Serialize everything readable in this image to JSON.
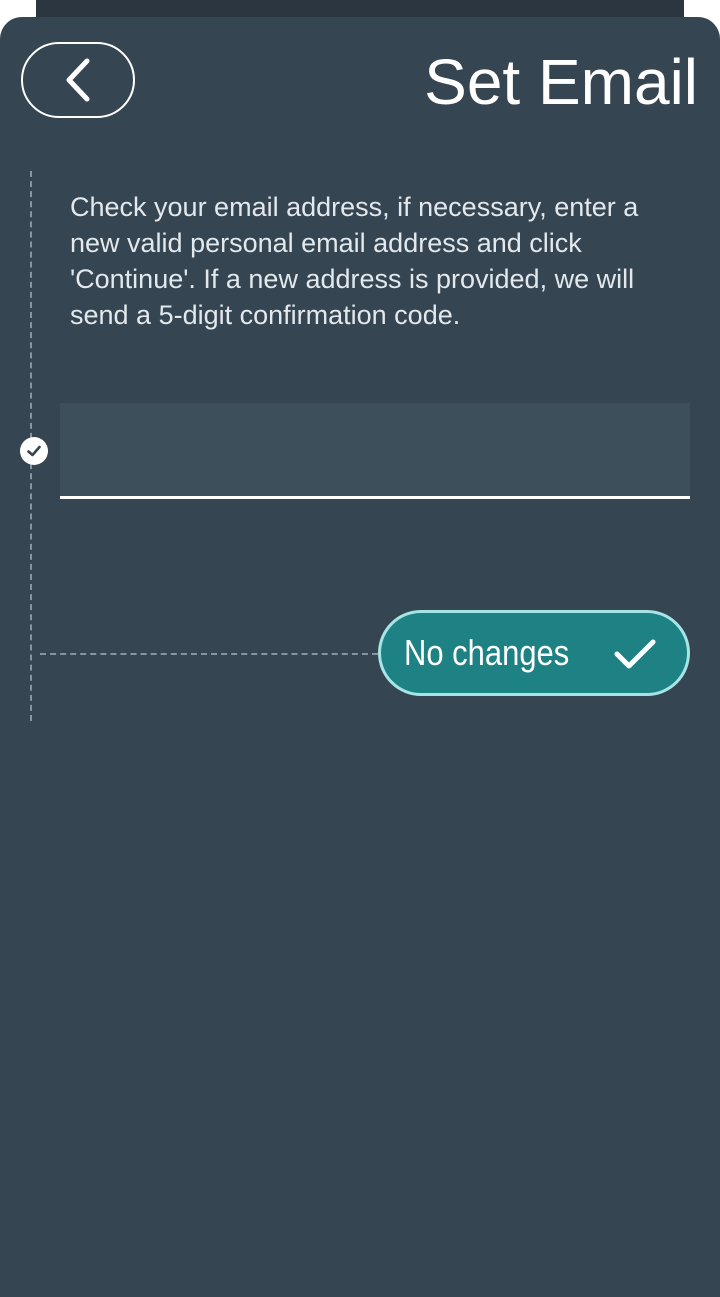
{
  "header": {
    "title": "Set Email",
    "back_icon": "chevron-left-icon"
  },
  "main": {
    "instruction": "Check your email address, if necessary, enter a new valid personal email address and click 'Continue'. If a new address is provided, we will send a 5-digit confirmation code.",
    "email_input": {
      "value": "",
      "placeholder": ""
    },
    "step_icon": "check-circle-icon",
    "action_button": {
      "label": "No changes",
      "icon": "checkmark-icon"
    }
  },
  "colors": {
    "background": "#364552",
    "input_background": "#3e4f5c",
    "accent": "#1e8285",
    "accent_border": "#a6e5e6",
    "text": "#ffffff"
  }
}
